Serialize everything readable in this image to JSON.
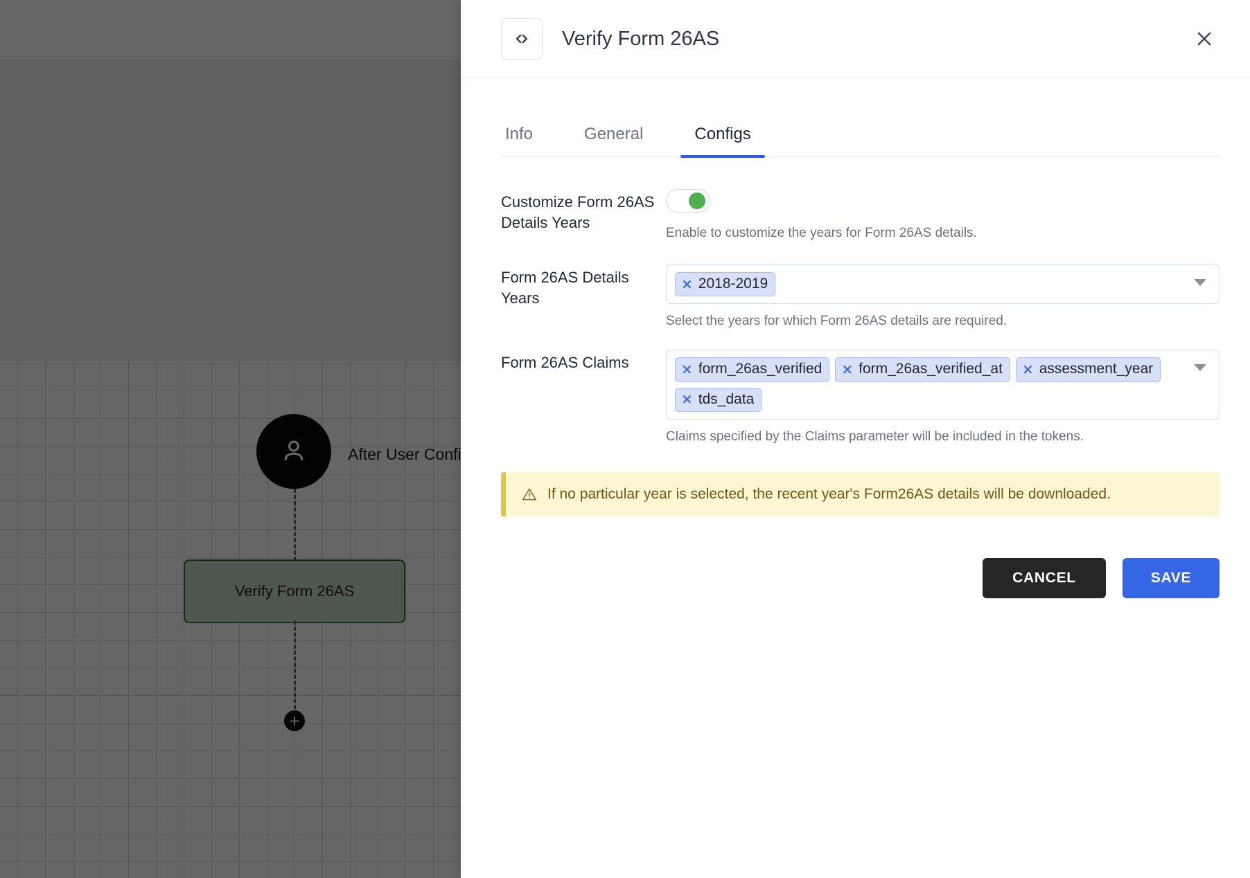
{
  "canvas": {
    "user_node_label": "After User Confi",
    "task_node_label": "Verify Form 26AS",
    "add_button_label": "+"
  },
  "drawer": {
    "icon": "code-icon",
    "title": "Verify Form 26AS",
    "close_icon": "close-icon",
    "tabs": [
      {
        "label": "Info",
        "active": false
      },
      {
        "label": "General",
        "active": false
      },
      {
        "label": "Configs",
        "active": true
      }
    ],
    "fields": {
      "customize_years": {
        "label": "Customize Form 26AS Details Years",
        "toggle_state": "on",
        "helper": "Enable to customize the years for Form 26AS details."
      },
      "details_years": {
        "label": "Form 26AS Details Years",
        "chips": [
          "2018-2019"
        ],
        "helper": "Select the years for which Form 26AS details are required.",
        "caret_icon": "chevron-down-icon"
      },
      "claims": {
        "label": "Form 26AS Claims",
        "chips": [
          "form_26as_verified",
          "form_26as_verified_at",
          "assessment_year",
          "tds_data"
        ],
        "helper": "Claims specified by the Claims parameter will be included in the tokens.",
        "caret_icon": "chevron-down-icon"
      }
    },
    "warning": {
      "icon": "warning-triangle-icon",
      "text": "If no particular year is selected, the recent year's Form26AS details will be downloaded."
    },
    "buttons": {
      "cancel": "CANCEL",
      "save": "SAVE"
    }
  },
  "colors": {
    "accent_blue": "#3566e3",
    "tab_underline": "#2f5bea",
    "toggle_on": "#4caf50",
    "chip_bg": "#d7e0f6",
    "chip_border": "#a8bdee",
    "chip_x": "#4272e0",
    "warning_bg": "#fdf6d3",
    "warning_border": "#e3c445",
    "cancel_bg": "#262626",
    "node_border": "#2f6b35"
  },
  "chip_remove_glyph": "×"
}
